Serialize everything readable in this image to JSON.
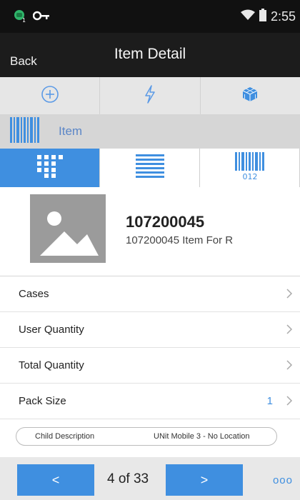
{
  "status_bar": {
    "time": "2:55",
    "icons": [
      "android-badge-icon",
      "key-icon",
      "wifi-icon",
      "battery-icon"
    ]
  },
  "title_bar": {
    "back_label": "Back",
    "title": "Item Detail"
  },
  "toolbar": {
    "icons": [
      "add-circle-icon",
      "lightning-icon",
      "cube-icon"
    ],
    "accent_color": "#3f8fe0"
  },
  "scan": {
    "label": "Item",
    "icon": "barcode-icon"
  },
  "tabs": [
    {
      "icon": "grid-icon",
      "active": true
    },
    {
      "icon": "list-icon",
      "active": false
    },
    {
      "icon": "barcode-number-icon",
      "active": false,
      "label": "012"
    }
  ],
  "item": {
    "number": "107200045",
    "description": "107200045 Item For R",
    "image_icon": "image-placeholder-icon"
  },
  "rows": [
    {
      "label": "Cases",
      "value": ""
    },
    {
      "label": "User Quantity",
      "value": ""
    },
    {
      "label": "Total Quantity",
      "value": ""
    },
    {
      "label": "Pack Size",
      "value": "1"
    }
  ],
  "child_description": {
    "label": "Child Description",
    "value": "UNit Mobile 3 - No Location"
  },
  "footer": {
    "prev_label": "<",
    "next_label": ">",
    "page": "4 of 33",
    "more_label": "ooo"
  }
}
